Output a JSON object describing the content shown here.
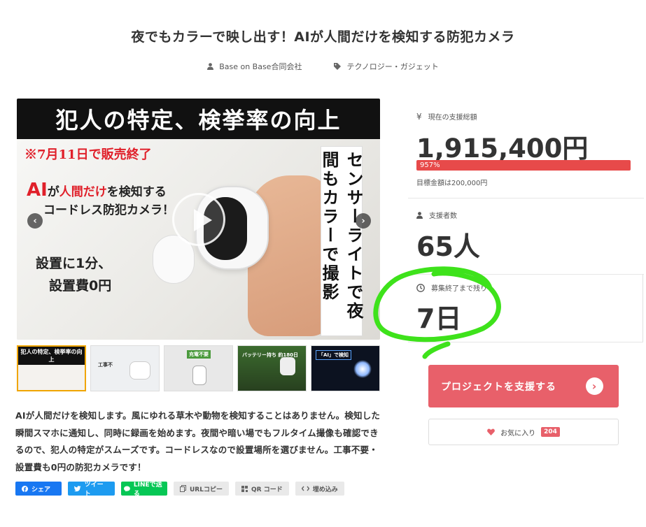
{
  "project": {
    "title": "夜でもカラーで映し出す！AIが人間だけを検知する防犯カメラ",
    "owner": "Base on Base合同会社",
    "category": "テクノロジー・ガジェット"
  },
  "hero": {
    "band_text": "犯人の特定、検挙率の向上",
    "sale_end": "※7月11日で販売終了",
    "ai_line1_ai": "AI",
    "ai_line1_mid": "が",
    "ai_line1_red": "人間だけ",
    "ai_line1_end": "を検知する",
    "ai_line2": "コードレス防犯カメラ！",
    "setup_line1": "設置に1分、",
    "setup_line2": "設置費0円",
    "vertical_text": "センサーライトで夜間もカラーで撮影",
    "prev_arrow": "‹",
    "next_arrow": "›"
  },
  "thumbnails": [
    {
      "label": "犯人の特定、検挙率の向上",
      "active": true
    },
    {
      "label": "工事不",
      "active": false
    },
    {
      "label": "充電不要",
      "active": false
    },
    {
      "label": "バッテリー持ち 約180日",
      "active": false
    },
    {
      "label": "「AI」で検知",
      "active": false
    }
  ],
  "description": "AIが人間だけを検知します。風にゆれる草木や動物を検知することはありません。検知した瞬間スマホに通知し、同時に録画を始めます。夜間や暗い場で​もフルタイム撮像も確認できるので、犯人の特定がスムーズです。コードレスなので設置場所を選びません。工事不要・設置費も0円の防犯カメラです！",
  "share": {
    "facebook": "シェア",
    "twitter": "ツイート",
    "line": "LINEで送る",
    "url_copy": "URLコピー",
    "qr": "QR コード",
    "embed": "埋め込み"
  },
  "stats": {
    "total_label": "現在の支援総額",
    "total_icon": "¥",
    "total_value": "1,915,400円",
    "progress_text": "957%",
    "progress_percent": 957,
    "goal_text": "目標金額は200,000円",
    "backers_label": "支援者数",
    "backers_value": "65人",
    "remaining_label": "募集終了まで残り",
    "remaining_value": "7日"
  },
  "actions": {
    "support_label": "プロジェクトを支援する",
    "favorite_label": "お気に入り",
    "favorite_count": "204"
  },
  "colors": {
    "accent": "#e8606a",
    "progress": "#e74a4a",
    "annotation": "#3ee21b"
  }
}
